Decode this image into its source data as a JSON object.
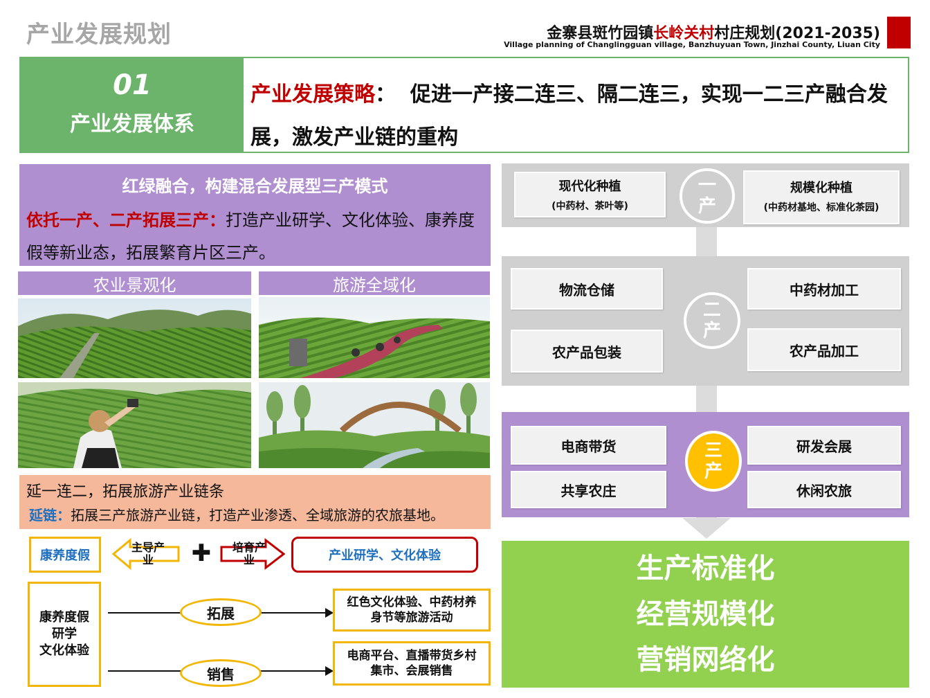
{
  "header": {
    "page_title": "产业发展规划",
    "doc_title_prefix": "金寨县斑竹园镇",
    "doc_title_highlight": "长岭关村",
    "doc_title_suffix": "村庄规划(2021-2035)",
    "doc_subtitle": "Village planning of Changlingguan village, Banzhuyuan Town, Jinzhai County, Liuan City"
  },
  "banner": {
    "number": "01",
    "caption": "产业发展体系",
    "strategy_label": "产业发展策略",
    "strategy_colon": "：",
    "strategy_text": "促进一产接二连三、隔二连三，实现一二三产融合发展，激发产业链的重构"
  },
  "left": {
    "purple_title": "红绿融合，构建混合发展型三产模式",
    "purple_highlight": "依托一产、二产拓展三产：",
    "purple_text": "打造产业研学、文化体验、康养度假等新业态，拓展繁育片区三产。",
    "image_labels": [
      "农业景观化",
      "旅游全域化"
    ],
    "orange_line1": "延一连二，拓展旅游产业链条",
    "orange_label": "延链：",
    "orange_text": "拓展三产旅游产业链，打造产业渗透、全域旅游的农旅基地。",
    "diagram": {
      "box_left_top": "康养度假",
      "arrow_main": "主导产业",
      "plus": "✚",
      "arrow_grow": "培育产业",
      "box_right_top": "产业研学、文化体验",
      "box_left_big": [
        "康养度假",
        "研学",
        "文化体验"
      ],
      "oval_expand": "拓展",
      "oval_sell": "销售",
      "box_expand": "红色文化体验、中药材养身节等旅游活动",
      "box_sell": "电商平台、直播带货乡村集市、会展销售"
    }
  },
  "right": {
    "primary": {
      "circle": [
        "一",
        "产"
      ],
      "card_left": {
        "title": "现代化种植",
        "note": "(中药材、茶叶等)"
      },
      "card_right": {
        "title": "规模化种植",
        "note": "(中药材基地、标准化茶园)"
      }
    },
    "secondary": {
      "circle": [
        "二",
        "产"
      ],
      "cards": [
        "物流仓储",
        "中药材加工",
        "农产品包装",
        "农产品加工"
      ]
    },
    "tertiary": {
      "circle": [
        "三",
        "产"
      ],
      "cards": [
        "电商带货",
        "研发会展",
        "共享农庄",
        "休闲农旅"
      ]
    },
    "outcomes": [
      "生产标准化",
      "经营规模化",
      "营销网络化"
    ]
  },
  "colors": {
    "green": "#6cb36c",
    "purple": "#b08fd0",
    "orange": "#f5b89a",
    "red": "#c00000",
    "yellow": "#f2b705",
    "light_green": "#92d050"
  }
}
